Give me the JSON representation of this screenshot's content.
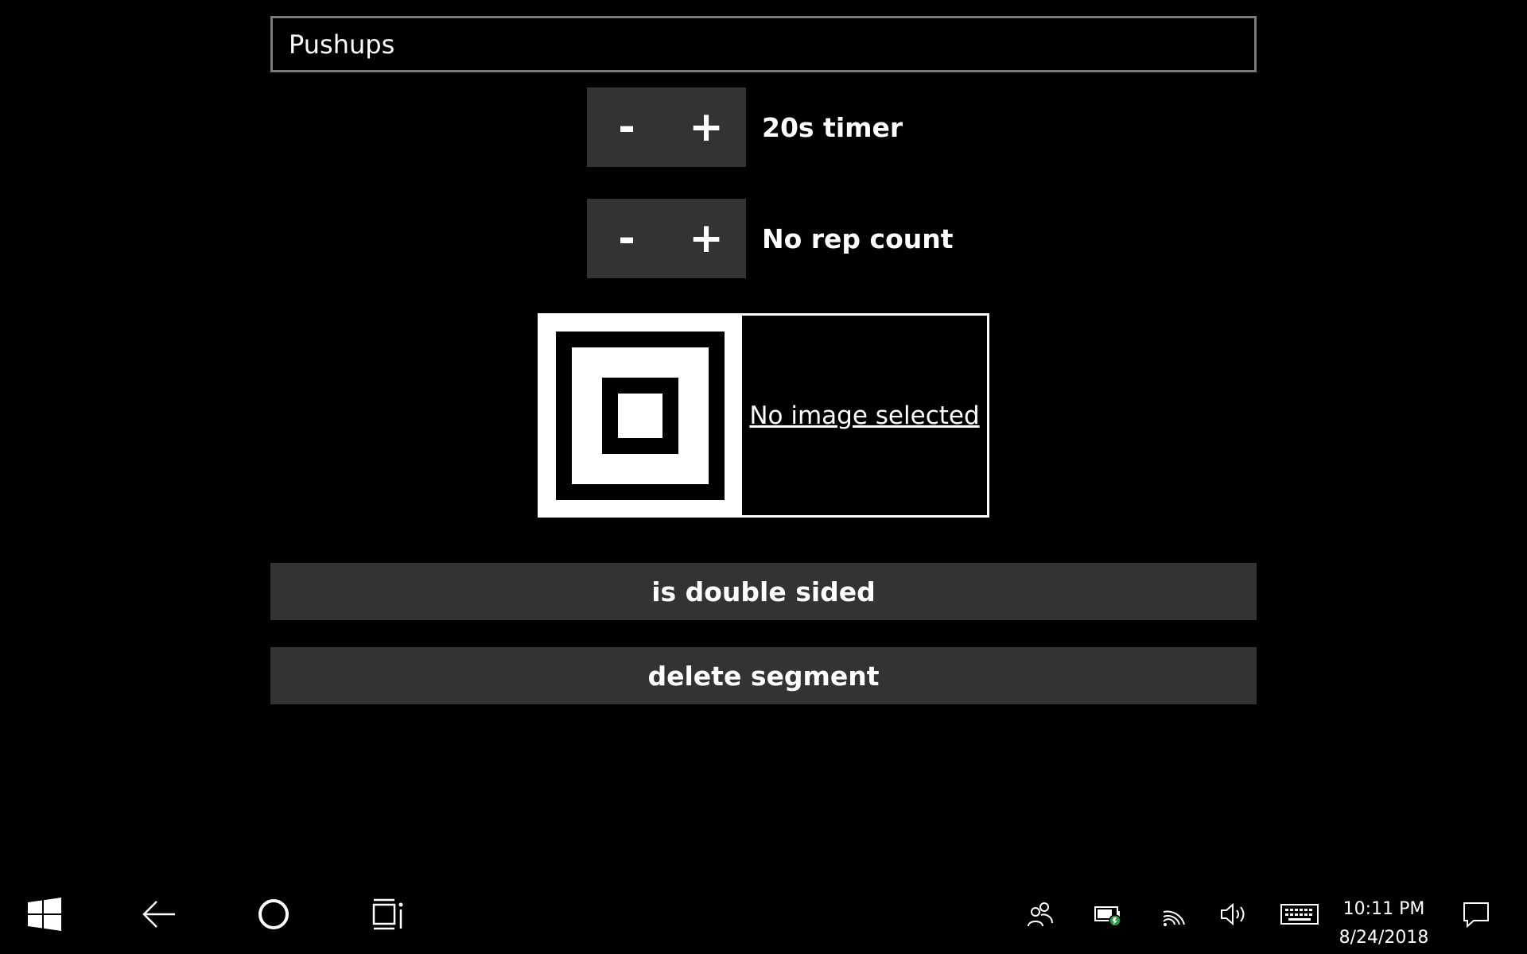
{
  "segment": {
    "name_value": "Pushups",
    "name_placeholder": ""
  },
  "timer_stepper": {
    "minus_label": "-",
    "plus_label": "+",
    "status": "20s timer"
  },
  "reps_stepper": {
    "minus_label": "-",
    "plus_label": "+",
    "status": "No rep count"
  },
  "image_picker": {
    "link_text": "No image selected"
  },
  "actions": {
    "double_sided_label": "is double sided",
    "delete_label": "delete segment"
  },
  "taskbar": {
    "time": "10:11 PM",
    "date": "8/24/2018",
    "icons": [
      "windows-start-icon",
      "back-arrow-icon",
      "cortana-icon",
      "task-view-icon",
      "people-icon",
      "battery-icon",
      "wifi-icon",
      "volume-icon",
      "keyboard-icon",
      "action-center-icon"
    ]
  },
  "colors": {
    "background": "#000000",
    "button": "#333333",
    "input_border": "#7a7a7a",
    "text": "#ffffff",
    "battery_accent": "#1f9e3a"
  }
}
